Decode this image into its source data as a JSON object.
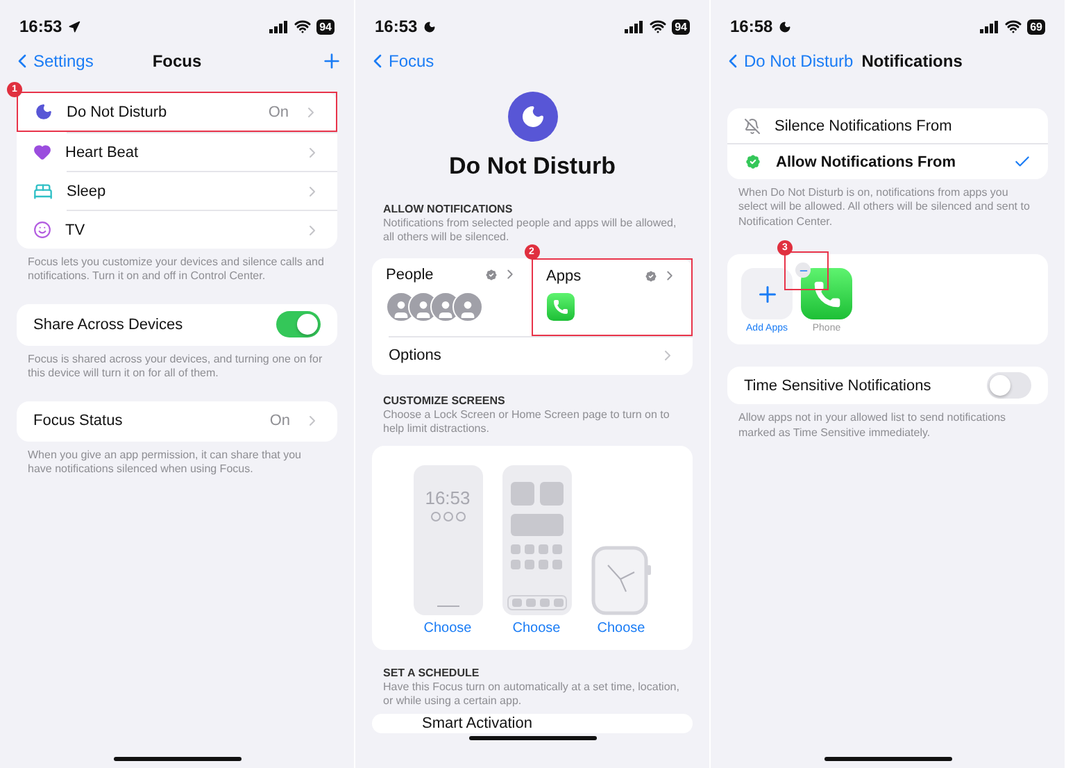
{
  "focus_screen": {
    "status_bar": {
      "time": "16:53",
      "kind": "location",
      "battery": "94"
    },
    "nav": {
      "back": "Settings",
      "title": "Focus"
    },
    "callout": {
      "number": "1"
    },
    "modes": [
      {
        "kind": "moon",
        "label": "Do Not Disturb",
        "value": "On",
        "highlighted": true
      },
      {
        "kind": "heart",
        "label": "Heart Beat",
        "highlighted": false
      },
      {
        "kind": "bed",
        "label": "Sleep",
        "highlighted": false
      },
      {
        "kind": "tv",
        "label": "TV",
        "highlighted": false
      }
    ],
    "modes_note": "Focus lets you customize your devices and silence calls and notifications. Turn it on and off in Control Center.",
    "share": {
      "label": "Share Across Devices",
      "on": true
    },
    "share_note": "Focus is shared across your devices, and turning one on for this device will turn it on for all of them.",
    "status": {
      "label": "Focus Status",
      "value": "On"
    },
    "status_note": "When you give an app permission, it can share that you have notifications silenced when using Focus."
  },
  "dnd_screen": {
    "status_bar": {
      "time": "16:53",
      "kind": "moon",
      "battery": "94"
    },
    "nav": {
      "back": "Focus"
    },
    "title": "Do Not Disturb",
    "allow": {
      "header": "ALLOW NOTIFICATIONS",
      "note": "Notifications from selected people and apps will be allowed, all others will be silenced.",
      "people": {
        "label": "People"
      },
      "apps": {
        "label": "Apps",
        "highlighted": true
      },
      "callout": {
        "number": "2"
      },
      "options": "Options"
    },
    "customize": {
      "header": "CUSTOMIZE SCREENS",
      "note": "Choose a Lock Screen or Home Screen page to turn on to help limit distractions.",
      "options": [
        {
          "kind": "lock",
          "time": "16:53",
          "label": "Choose"
        },
        {
          "kind": "home",
          "label": "Choose"
        },
        {
          "kind": "watch",
          "label": "Choose"
        }
      ]
    },
    "schedule": {
      "header": "SET A SCHEDULE",
      "note": "Have this Focus turn on automatically at a set time, location, or while using a certain app.",
      "first_row": "Smart Activation"
    }
  },
  "notifications_screen": {
    "status_bar": {
      "time": "16:58",
      "kind": "moon",
      "battery": "69"
    },
    "nav": {
      "back": "Do Not Disturb",
      "title": "Notifications"
    },
    "modes": [
      {
        "kind": "silence",
        "label": "Silence Notifications From",
        "selected": false
      },
      {
        "kind": "allow",
        "label": "Allow Notifications From",
        "selected": true
      }
    ],
    "modes_note": "When Do Not Disturb is on, notifications from apps you select will be allowed. All others will be silenced and sent to Notification Center.",
    "callout": {
      "number": "3"
    },
    "apps": [
      {
        "kind": "add",
        "label": "Add Apps"
      },
      {
        "kind": "phone",
        "label": "Phone"
      }
    ],
    "time_sensitive": {
      "label": "Time Sensitive Notifications",
      "on": false
    },
    "time_sensitive_note": "Allow apps not in your allowed list to send notifications marked as Time Sensitive immediately."
  }
}
